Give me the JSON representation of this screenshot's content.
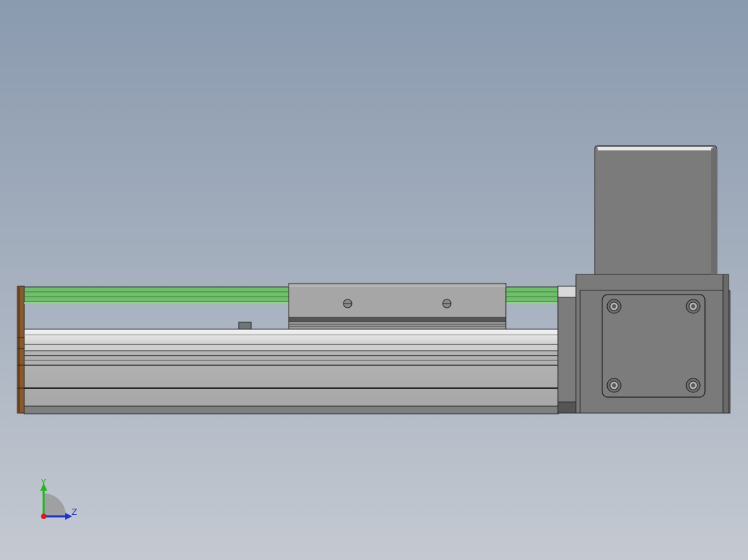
{
  "viewport": {
    "background_top": "#8a9aaf",
    "background_bottom": "#c4c9d1"
  },
  "model": {
    "parts": [
      "end-cap",
      "guide-rail",
      "base-profile",
      "carriage",
      "motor-adapter",
      "motor-flange",
      "stepper-motor",
      "mounting-screws"
    ],
    "colors": {
      "rail_green": "#6fbf6a",
      "end_cap": "#8a5a2b",
      "carriage": "#a6a6a6",
      "base": "#b0b0b0",
      "motor": "#7a7a7a"
    }
  },
  "triad": {
    "y_label": "Y",
    "z_label": "Z",
    "y_color": "#1fb81f",
    "z_color": "#2030d0",
    "x_color": "#d02020"
  }
}
